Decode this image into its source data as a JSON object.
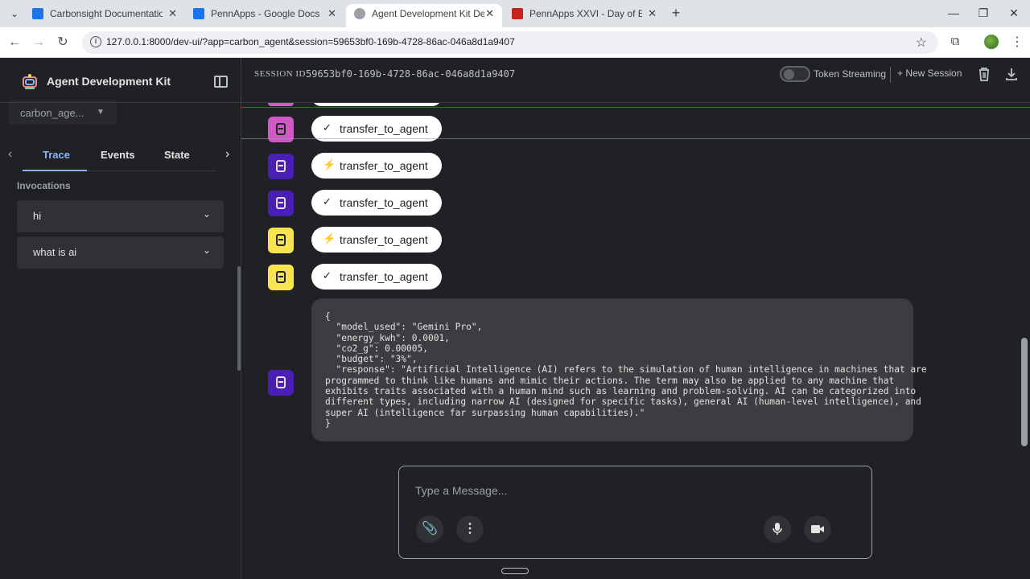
{
  "browser": {
    "tabs": [
      {
        "title": "Carbonsight Documentation - G",
        "favicon_color": "#1a73e8",
        "active": false
      },
      {
        "title": "PennApps - Google Docs",
        "favicon_color": "#1a73e8",
        "active": false
      },
      {
        "title": "Agent Development Kit Dev UI",
        "favicon_color": "#5f6368",
        "active": true
      },
      {
        "title": "PennApps XXVI - Day of Events",
        "favicon_color": "#c5221f",
        "active": false
      }
    ],
    "url": "127.0.0.1:8000/dev-ui/?app=carbon_agent&session=59653bf0-169b-4728-86ac-046a8d1a9407"
  },
  "sidebar": {
    "brand": "Agent Development Kit",
    "agent_select": "carbon_age...",
    "tabs": [
      {
        "label": "Trace",
        "selected": true
      },
      {
        "label": "Events",
        "selected": false
      },
      {
        "label": "State",
        "selected": false
      }
    ],
    "invocations_title": "Invocations",
    "invocations": [
      {
        "label": "hi"
      },
      {
        "label": "what is ai"
      }
    ]
  },
  "header": {
    "session_label": "SESSION ID",
    "session_id": "59653bf0-169b-4728-86ac-046a8d1a9407",
    "token_streaming_label": "Token Streaming",
    "token_streaming_on": false,
    "new_session_label": "New Session"
  },
  "chat": {
    "events": [
      {
        "kind": "response",
        "label": "transfer_to_agent",
        "avatar_color": "#d059c6",
        "icon_color": "#202124"
      },
      {
        "kind": "call",
        "label": "transfer_to_agent",
        "avatar_color": "#4a1fb8",
        "icon_color": "#e3e3e3"
      },
      {
        "kind": "response",
        "label": "transfer_to_agent",
        "avatar_color": "#4a1fb8",
        "icon_color": "#e3e3e3"
      },
      {
        "kind": "call",
        "label": "transfer_to_agent",
        "avatar_color": "#f8e44f",
        "icon_color": "#202124"
      },
      {
        "kind": "response",
        "label": "transfer_to_agent",
        "avatar_color": "#f8e44f",
        "icon_color": "#202124"
      }
    ],
    "response_text": "{\n  \"model_used\": \"Gemini Pro\",\n  \"energy_kwh\": 0.0001,\n  \"co2_g\": 0.00005,\n  \"budget\": \"3%\",\n  \"response\": \"Artificial Intelligence (AI) refers to the simulation of human intelligence in machines that are\nprogrammed to think like humans and mimic their actions. The term may also be applied to any machine that\nexhibits traits associated with a human mind such as learning and problem-solving. AI can be categorized into\ndifferent types, including narrow AI (designed for specific tasks), general AI (human-level intelligence), and\nsuper AI (intelligence far surpassing human capabilities).\"\n}",
    "response_avatar_color": "#4a1fb8"
  },
  "composer": {
    "placeholder": "Type a Message..."
  }
}
